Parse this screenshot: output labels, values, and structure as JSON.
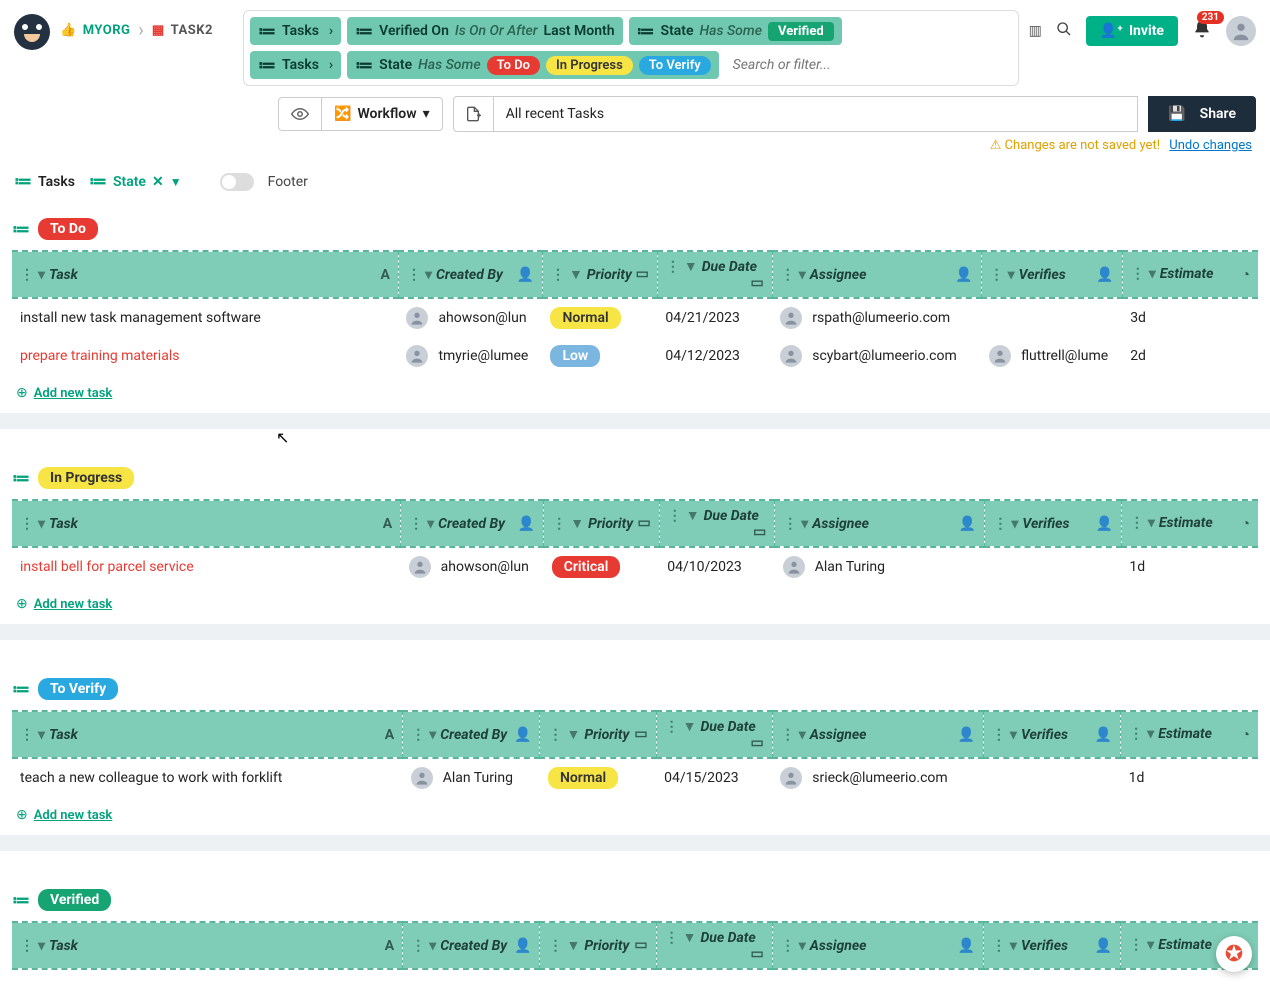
{
  "breadcrumb": {
    "org": "MYORG",
    "project": "TASK2"
  },
  "filters": {
    "row1": {
      "source": "Tasks",
      "field": "Verified On",
      "op": "Is On Or After",
      "value": "Last Month",
      "state_label": "State",
      "state_op": "Has Some",
      "state_value": "Verified"
    },
    "row2": {
      "source": "Tasks",
      "field": "State",
      "op": "Has Some",
      "pills": {
        "todo": "To Do",
        "progress": "In Progress",
        "verify": "To Verify"
      }
    },
    "search_placeholder": "Search or filter..."
  },
  "top_actions": {
    "invite": "Invite",
    "notifications": "231"
  },
  "toolbar": {
    "workflow": "Workflow",
    "search_text": "All recent Tasks",
    "share": "Share"
  },
  "warning": {
    "text": "Changes are not saved yet!",
    "link": "Undo changes"
  },
  "view": {
    "primary": "Tasks",
    "secondary": "State",
    "footer": "Footer"
  },
  "columns": {
    "task": "Task",
    "created_by": "Created By",
    "priority": "Priority",
    "due_date": "Due Date",
    "assignee": "Assignee",
    "verifies": "Verifies",
    "estimate": "Estimate"
  },
  "add_new": "Add new task",
  "groups": [
    {
      "key": "todo",
      "label": "To Do",
      "pill_class": "pill-todo",
      "rows": [
        {
          "task": "install new task management software",
          "red": false,
          "created_by": "ahowson@lun",
          "priority": "Normal",
          "priority_class": "prio-normal",
          "due": "04/21/2023",
          "assignee": "rspath@lumeerio.com",
          "verifies": "",
          "estimate": "3d"
        },
        {
          "task": "prepare training materials",
          "red": true,
          "created_by": "tmyrie@lumee",
          "priority": "Low",
          "priority_class": "prio-low",
          "due": "04/12/2023",
          "assignee": "scybart@lumeerio.com",
          "verifies": "fluttrell@lume",
          "estimate": "2d"
        }
      ]
    },
    {
      "key": "progress",
      "label": "In Progress",
      "pill_class": "pill-progress",
      "rows": [
        {
          "task": "install bell for parcel service",
          "red": true,
          "created_by": "ahowson@lun",
          "priority": "Critical",
          "priority_class": "prio-critical",
          "due": "04/10/2023",
          "assignee": "Alan Turing",
          "verifies": "",
          "estimate": "1d"
        }
      ]
    },
    {
      "key": "verify",
      "label": "To Verify",
      "pill_class": "pill-verify",
      "rows": [
        {
          "task": "teach a new colleague to work with forklift",
          "red": false,
          "created_by": "Alan Turing",
          "priority": "Normal",
          "priority_class": "prio-normal",
          "due": "04/15/2023",
          "assignee": "srieck@lumeerio.com",
          "verifies": "",
          "estimate": "1d"
        }
      ]
    },
    {
      "key": "verified",
      "label": "Verified",
      "pill_class": "pill-verified",
      "rows": []
    }
  ]
}
